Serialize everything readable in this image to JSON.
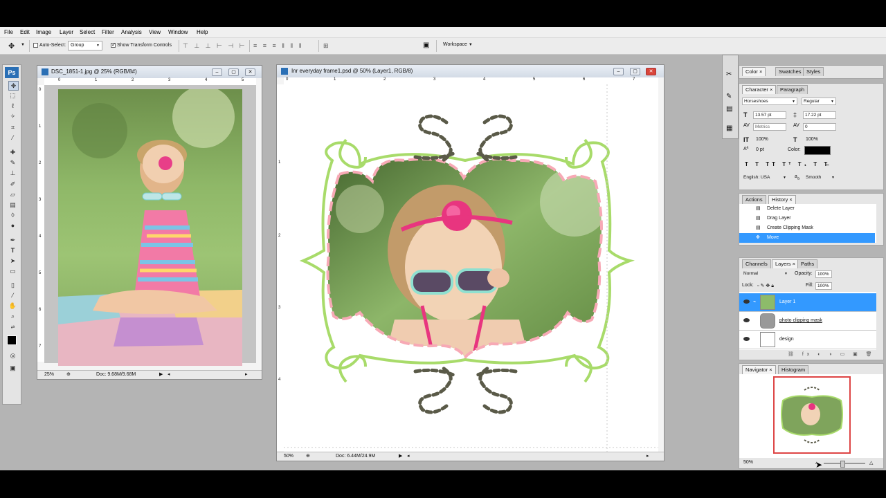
{
  "menubar": [
    "File",
    "Edit",
    "Image",
    "Layer",
    "Select",
    "Filter",
    "Analysis",
    "View",
    "Window",
    "Help"
  ],
  "options": {
    "auto_select_label": "Auto-Select:",
    "auto_select_value": "Group",
    "show_transform_label": "Show Transform Controls",
    "workspace_label": "Workspace"
  },
  "ps_logo": "Ps",
  "doc1": {
    "title": "DSC_1851-1.jpg @ 25% (RGB/8#)",
    "zoom": "25%",
    "doc_info": "Doc: 9.68M/9.68M",
    "ruler_h": [
      "0",
      "1",
      "2",
      "3",
      "4",
      "5"
    ],
    "ruler_v": [
      "0",
      "1",
      "2",
      "3",
      "4",
      "5",
      "6",
      "7"
    ]
  },
  "doc2": {
    "title": "Inr everyday frame1.psd @ 50% (Layer1, RGB/8)",
    "zoom": "50%",
    "doc_info": "Doc: 6.44M/24.9M",
    "ruler_h": [
      "0",
      "1",
      "2",
      "3",
      "4",
      "5",
      "6",
      "7"
    ],
    "ruler_v": [
      "1",
      "2",
      "3",
      "4"
    ]
  },
  "panel_color": {
    "tabs": [
      "Color",
      "Swatches",
      "Styles"
    ]
  },
  "panel_character": {
    "tabs": [
      "Character",
      "Paragraph"
    ],
    "font_family": "Horseshoes",
    "font_style": "Regular",
    "font_size": "13.57 pt",
    "leading": "17.22 pt",
    "kerning": "Metrics",
    "tracking": "0",
    "v_scale": "100%",
    "h_scale": "100%",
    "baseline": "0 pt",
    "color_label": "Color:",
    "language": "English: USA",
    "aa_label": "a",
    "aa_value": "Smooth"
  },
  "panel_history": {
    "tabs": [
      "Actions",
      "History"
    ],
    "items": [
      "Delete Layer",
      "Drag Layer",
      "Create Clipping Mask",
      "Move"
    ]
  },
  "panel_layers": {
    "tabs": [
      "Channels",
      "Layers",
      "Paths"
    ],
    "blend_mode": "Normal",
    "opacity_label": "Opacity:",
    "opacity": "100%",
    "lock_label": "Lock:",
    "fill_label": "Fill:",
    "fill": "100%",
    "layers": [
      "Layer 1",
      "photo clipping mask",
      "design"
    ]
  },
  "panel_navigator": {
    "tabs": [
      "Navigator",
      "Histogram"
    ],
    "zoom": "50%"
  },
  "colors": {
    "accent": "#3399ff",
    "frame_green": "#a8db6a",
    "swirl": "#5a5a48"
  }
}
